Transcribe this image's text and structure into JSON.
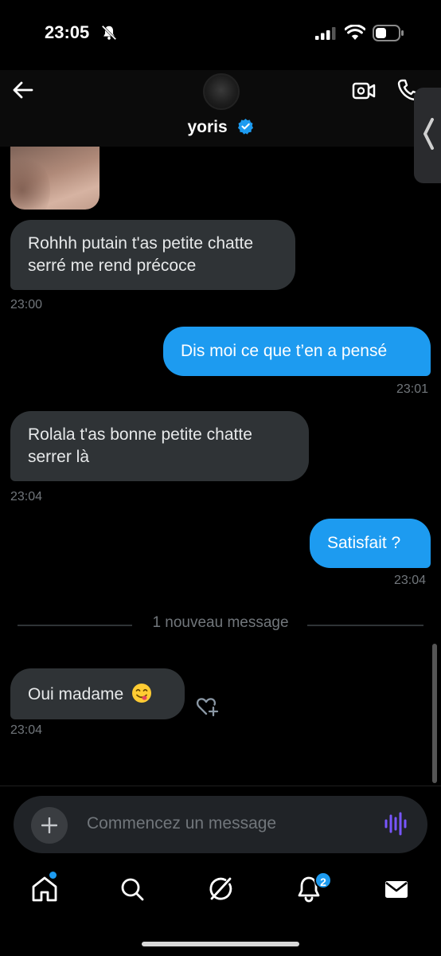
{
  "status_bar": {
    "time": "23:05"
  },
  "header": {
    "contact_name": "yoris"
  },
  "messages": [
    {
      "text": "Rohhh putain t'as petite chatte serré me rend précoce",
      "time": "23:00",
      "dir": "in"
    },
    {
      "text": "Dis moi ce que t’en a pensé",
      "time": "23:01",
      "dir": "out"
    },
    {
      "text": "Rolala t'as bonne petite chatte serrer là",
      "time": "23:04",
      "dir": "in"
    },
    {
      "text": "Satisfait ?",
      "time": "23:04",
      "dir": "out"
    },
    {
      "text": "Oui madame",
      "time": "23:04",
      "dir": "in",
      "emoji": "yum-face-emoji"
    }
  ],
  "divider": {
    "label": "1 nouveau message"
  },
  "composer": {
    "placeholder": "Commencez un message"
  },
  "bottom_nav": {
    "items": [
      "home-icon",
      "search-icon",
      "grok-icon",
      "notifications-icon",
      "messages-icon"
    ],
    "notification_count": "2"
  },
  "colors": {
    "accent": "#1d9bf0",
    "incoming_bubble": "#2f3336",
    "muted_text": "#71767b",
    "voice_icon": "#7856ff"
  }
}
